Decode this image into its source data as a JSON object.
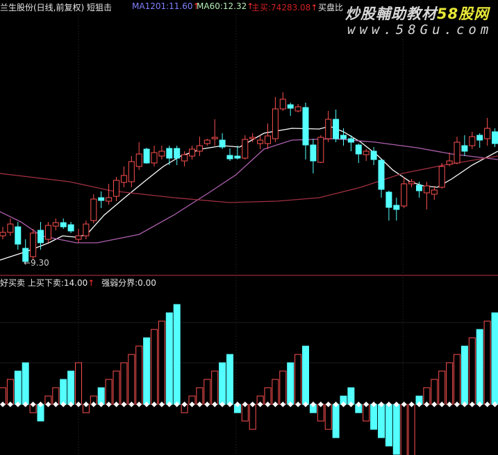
{
  "header": {
    "title": "兰生股份(日线,前复权) 短狙击",
    "ma1201": "MA1201:11.60",
    "ma60": "MA60:12.32",
    "zhumai": "主买:74283.08",
    "maipanbi": "买盘比",
    "arrow": "↑"
  },
  "watermark": {
    "line1_a": "炒股輔助教材",
    "line1_b": "58股网",
    "line2": "www.58Gu.com"
  },
  "lower_header": {
    "name": "好买卖",
    "v1": "上买下卖:14.00",
    "v2": "强弱分界:0.00",
    "arrow": "↑"
  },
  "low_label": "←9.30",
  "colors": {
    "up": "#ff5050",
    "down": "#54ffff",
    "ma_short": "#ffffff",
    "ma_mid": "#b060b0",
    "ma_long": "#a03040",
    "ma1201_text": "#8080ff",
    "ma60_text": "#b8f0b8"
  },
  "chart_data": [
    {
      "type": "candlestick",
      "title": "兰生股份(日线,前复权)",
      "ylim": [
        9.0,
        16.0
      ],
      "candles_ohlc": [
        [
          10.06,
          10.16,
          10.32,
          9.96
        ],
        [
          10.16,
          10.4,
          10.56,
          10.06
        ],
        [
          10.32,
          9.82,
          10.46,
          9.66
        ],
        [
          9.7,
          9.32,
          9.96,
          9.3
        ],
        [
          9.46,
          10.14,
          10.26,
          9.36
        ],
        [
          10.22,
          9.86,
          10.46,
          9.66
        ],
        [
          9.96,
          10.36,
          10.46,
          9.86
        ],
        [
          10.34,
          10.44,
          10.56,
          10.22
        ],
        [
          10.44,
          10.32,
          10.56,
          10.26
        ],
        [
          10.38,
          10.2,
          10.46,
          10.14
        ],
        [
          9.96,
          10.06,
          10.26,
          9.86
        ],
        [
          10.06,
          10.4,
          10.5,
          9.96
        ],
        [
          10.5,
          11.12,
          11.26,
          10.42
        ],
        [
          11.16,
          11.08,
          11.34,
          10.86
        ],
        [
          11.06,
          11.16,
          11.56,
          10.96
        ],
        [
          11.2,
          11.66,
          11.76,
          11.06
        ],
        [
          11.6,
          11.8,
          12.06,
          11.46
        ],
        [
          11.62,
          12.2,
          12.36,
          11.46
        ],
        [
          12.06,
          12.42,
          12.76,
          11.96
        ],
        [
          12.56,
          12.16,
          12.6,
          12.14
        ],
        [
          12.16,
          12.46,
          12.66,
          12.06
        ],
        [
          12.36,
          12.5,
          12.66,
          12.26
        ],
        [
          12.58,
          12.3,
          12.66,
          12.1
        ],
        [
          12.58,
          12.3,
          12.66,
          12.1
        ],
        [
          12.22,
          12.4,
          12.5,
          12.06
        ],
        [
          12.36,
          12.56,
          12.66,
          12.26
        ],
        [
          12.5,
          12.66,
          12.92,
          12.36
        ],
        [
          12.72,
          12.82,
          12.86,
          12.66
        ],
        [
          12.86,
          12.9,
          13.42,
          12.66
        ],
        [
          12.82,
          12.62,
          13.02,
          12.56
        ],
        [
          12.38,
          12.28,
          12.58,
          12.22
        ],
        [
          12.36,
          12.3,
          12.66,
          12.26
        ],
        [
          12.3,
          12.84,
          12.96,
          12.26
        ],
        [
          12.86,
          12.9,
          13.02,
          12.76
        ],
        [
          12.72,
          12.82,
          12.96,
          12.56
        ],
        [
          12.72,
          12.94,
          13.3,
          12.56
        ],
        [
          12.86,
          13.72,
          14.06,
          12.76
        ],
        [
          13.72,
          14.0,
          14.2,
          13.66
        ],
        [
          13.84,
          13.74,
          13.9,
          13.52
        ],
        [
          13.66,
          13.78,
          13.86,
          13.62
        ],
        [
          13.76,
          12.68,
          13.9,
          12.26
        ],
        [
          12.68,
          12.22,
          12.86,
          11.86
        ],
        [
          12.18,
          12.9,
          12.96,
          12.16
        ],
        [
          12.86,
          13.42,
          13.66,
          12.76
        ],
        [
          13.42,
          12.86,
          13.7,
          12.76
        ],
        [
          12.96,
          12.86,
          13.16,
          12.66
        ],
        [
          12.86,
          12.76,
          12.96,
          12.5
        ],
        [
          12.68,
          12.42,
          12.72,
          12.16
        ],
        [
          12.4,
          12.5,
          12.56,
          12.22
        ],
        [
          12.5,
          12.26,
          12.62,
          12.1
        ],
        [
          12.24,
          11.4,
          12.26,
          11.16
        ],
        [
          11.32,
          10.88,
          11.36,
          10.5
        ],
        [
          10.94,
          10.82,
          11.16,
          10.5
        ],
        [
          10.92,
          11.56,
          11.76,
          10.86
        ],
        [
          11.56,
          11.62,
          11.7,
          11.46
        ],
        [
          11.52,
          11.36,
          11.62,
          11.16
        ],
        [
          11.3,
          11.5,
          11.62,
          10.82
        ],
        [
          11.26,
          11.38,
          11.5,
          11.1
        ],
        [
          11.46,
          12.06,
          12.16,
          11.42
        ],
        [
          12.12,
          12.22,
          12.46,
          12.06
        ],
        [
          12.16,
          12.76,
          12.92,
          12.12
        ],
        [
          12.66,
          12.5,
          12.96,
          12.36
        ],
        [
          12.66,
          12.92,
          13.06,
          12.56
        ],
        [
          12.96,
          12.82,
          13.02,
          12.6
        ],
        [
          12.86,
          13.16,
          13.46,
          12.66
        ],
        [
          13.06,
          12.72,
          13.16,
          12.62
        ]
      ],
      "lines": [
        {
          "name": "ma-short",
          "points": [
            [
              -0.4,
              9.36
            ],
            [
              3.3,
              9.62
            ],
            [
              6.1,
              9.86
            ],
            [
              7.9,
              10.06
            ],
            [
              9.7,
              10.02
            ],
            [
              11.1,
              10.1
            ],
            [
              13.4,
              10.66
            ],
            [
              16.1,
              11.16
            ],
            [
              18.9,
              11.66
            ],
            [
              21.2,
              12.06
            ],
            [
              23.5,
              12.36
            ],
            [
              26.2,
              12.56
            ],
            [
              29,
              12.66
            ],
            [
              31.3,
              12.62
            ],
            [
              34.5,
              13.02
            ],
            [
              38.2,
              13.16
            ],
            [
              41.8,
              13.14
            ],
            [
              43.2,
              13.22
            ],
            [
              45,
              13.06
            ],
            [
              47.3,
              12.76
            ],
            [
              49.6,
              12.36
            ],
            [
              51.5,
              11.96
            ],
            [
              53.8,
              11.62
            ],
            [
              55.6,
              11.5
            ],
            [
              57.4,
              11.46
            ],
            [
              59.3,
              11.7
            ],
            [
              62,
              12.1
            ],
            [
              65.4,
              12.5
            ]
          ]
        },
        {
          "name": "ma-mid",
          "points": [
            [
              -0.4,
              10.76
            ],
            [
              2.4,
              10.46
            ],
            [
              5.1,
              10.06
            ],
            [
              9.7,
              9.86
            ],
            [
              12.5,
              9.86
            ],
            [
              18,
              10.1
            ],
            [
              22.6,
              10.66
            ],
            [
              27.2,
              11.3
            ],
            [
              30.8,
              11.82
            ],
            [
              34.5,
              12.56
            ],
            [
              38.2,
              12.82
            ],
            [
              43.7,
              12.86
            ],
            [
              49.2,
              12.76
            ],
            [
              54.7,
              12.6
            ],
            [
              59.3,
              12.42
            ],
            [
              65.4,
              12.26
            ]
          ]
        },
        {
          "name": "ma-long",
          "points": [
            [
              -0.4,
              11.86
            ],
            [
              8.8,
              11.62
            ],
            [
              14.3,
              11.36
            ],
            [
              22.6,
              11.16
            ],
            [
              29.9,
              11.02
            ],
            [
              36.3,
              11.06
            ],
            [
              41.8,
              11.16
            ],
            [
              47.3,
              11.46
            ],
            [
              52.8,
              11.86
            ],
            [
              58.3,
              12.1
            ],
            [
              65.4,
              12.36
            ]
          ]
        }
      ]
    },
    {
      "type": "bar",
      "title": "好买卖",
      "ylim": [
        -6,
        12
      ],
      "values": [
        2,
        3,
        4,
        5,
        -1,
        -2,
        1,
        2,
        3,
        4,
        5,
        -1,
        1,
        2,
        3,
        4,
        5,
        6,
        7,
        8,
        9,
        10,
        11,
        12,
        -1,
        1,
        2,
        3,
        4,
        5,
        6,
        -1,
        -2,
        -3,
        1,
        2,
        3,
        4,
        5,
        6,
        7,
        -1,
        -2,
        -3,
        -4,
        1,
        2,
        -1,
        -2,
        -3,
        -4,
        -5,
        -6,
        -7,
        -8,
        1,
        2,
        3,
        4,
        5,
        6,
        7,
        8,
        9,
        10,
        11
      ],
      "colors": [
        "r",
        "r",
        "c",
        "c",
        "r",
        "c",
        "r",
        "r",
        "c",
        "c",
        "r",
        "r",
        "r",
        "c",
        "r",
        "r",
        "r",
        "r",
        "r",
        "c",
        "r",
        "r",
        "c",
        "c",
        "r",
        "r",
        "r",
        "r",
        "r",
        "c",
        "c",
        "c",
        "r",
        "r",
        "r",
        "r",
        "r",
        "r",
        "c",
        "r",
        "c",
        "c",
        "r",
        "r",
        "c",
        "c",
        "c",
        "c",
        "r",
        "c",
        "c",
        "c",
        "c",
        "r",
        "r",
        "c",
        "r",
        "r",
        "r",
        "r",
        "r",
        "c",
        "r",
        "c",
        "r",
        "c"
      ]
    }
  ]
}
